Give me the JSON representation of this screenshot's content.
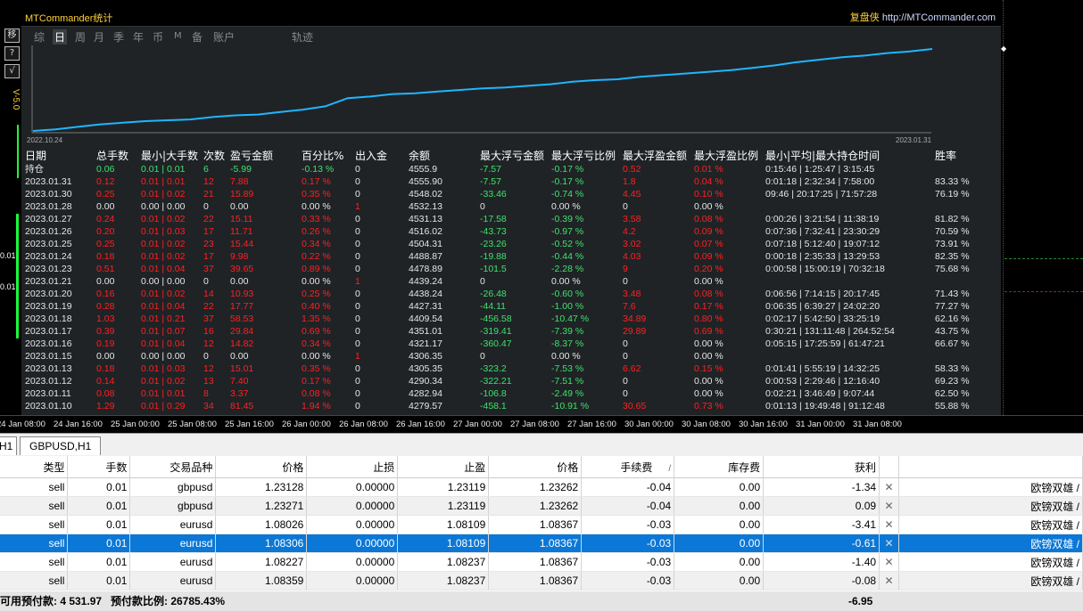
{
  "panel": {
    "title": "MTCommander统计",
    "site_label": "复盘侠",
    "site_url": "http://MTCommander.com",
    "tabs": [
      "综",
      "日",
      "周",
      "月",
      "季",
      "年",
      "币",
      "M",
      "备",
      "账户",
      "轨迹"
    ],
    "active_tab": "日"
  },
  "toolbar": {
    "buttons": [
      "移",
      "?",
      "√"
    ],
    "version": "V-5.0"
  },
  "equity": {
    "start_date": "2022.10.24",
    "end_date": "2023.01.31",
    "line_color": "#1fb6ff",
    "points": [
      0,
      0.02,
      0.05,
      0.08,
      0.1,
      0.12,
      0.13,
      0.14,
      0.17,
      0.19,
      0.2,
      0.23,
      0.26,
      0.3,
      0.4,
      0.42,
      0.45,
      0.46,
      0.48,
      0.5,
      0.52,
      0.53,
      0.55,
      0.57,
      0.6,
      0.62,
      0.63,
      0.66,
      0.68,
      0.7,
      0.72,
      0.74,
      0.77,
      0.8,
      0.84,
      0.87,
      0.9,
      0.92,
      0.95,
      0.97,
      1
    ]
  },
  "stats": {
    "headers": [
      "日期",
      "总手数",
      "最小|大手数",
      "次数",
      "盈亏金额",
      "百分比%",
      "出入金",
      "余额",
      "最大浮亏金额",
      "最大浮亏比例",
      "最大浮盈金额",
      "最大浮盈比例",
      "最小|平均|最大持仓时间",
      "胜率"
    ],
    "rows": [
      {
        "date": "持仓",
        "c": "g",
        "lots": "0.06",
        "minmax": "0.01 | 0.01",
        "n": "6",
        "pl": "-5.99",
        "pct": "-0.13 %",
        "io": "0",
        "bal": "4555.9",
        "mfl": "-7.57",
        "mflp": "-0.17 %",
        "mfp": "0.52",
        "mfpp": "0.01 %",
        "time": "0:15:46 | 1:25:47 | 3:15:45",
        "win": ""
      },
      {
        "date": "2023.01.31",
        "c": "r",
        "lots": "0.12",
        "minmax": "0.01 | 0.01",
        "n": "12",
        "pl": "7.88",
        "pct": "0.17 %",
        "io": "0",
        "bal": "4555.90",
        "mfl": "-7.57",
        "mflp": "-0.17 %",
        "mfp": "1.8",
        "mfpp": "0.04 %",
        "time": "0:01:18 | 2:32:34 | 7:58:00",
        "win": "83.33 %"
      },
      {
        "date": "2023.01.30",
        "c": "r",
        "lots": "0.25",
        "minmax": "0.01 | 0.02",
        "n": "21",
        "pl": "15.89",
        "pct": "0.35 %",
        "io": "0",
        "bal": "4548.02",
        "mfl": "-33.46",
        "mflp": "-0.74 %",
        "mfp": "4.45",
        "mfpp": "0.10 %",
        "time": "09:46 | 20:17:25 | 71:57:28",
        "win": "76.19 %"
      },
      {
        "date": "2023.01.28",
        "c": "w",
        "lots": "0.00",
        "minmax": "0.00 | 0.00",
        "n": "0",
        "pl": "0.00",
        "pct": "0.00 %",
        "io": "1",
        "bal": "4532.13",
        "mfl": "0",
        "mflp": "0.00 %",
        "mfp": "0",
        "mfpp": "0.00 %",
        "time": "",
        "win": ""
      },
      {
        "date": "2023.01.27",
        "c": "r",
        "lots": "0.24",
        "minmax": "0.01 | 0.02",
        "n": "22",
        "pl": "15.11",
        "pct": "0.33 %",
        "io": "0",
        "bal": "4531.13",
        "mfl": "-17.58",
        "mflp": "-0.39 %",
        "mfp": "3.58",
        "mfpp": "0.08 %",
        "time": "0:00:26 | 3:21:54 | 11:38:19",
        "win": "81.82 %"
      },
      {
        "date": "2023.01.26",
        "c": "r",
        "lots": "0.20",
        "minmax": "0.01 | 0.03",
        "n": "17",
        "pl": "11.71",
        "pct": "0.26 %",
        "io": "0",
        "bal": "4516.02",
        "mfl": "-43.73",
        "mflp": "-0.97 %",
        "mfp": "4.2",
        "mfpp": "0.09 %",
        "time": "0:07:36 | 7:32:41 | 23:30:29",
        "win": "70.59 %"
      },
      {
        "date": "2023.01.25",
        "c": "r",
        "lots": "0.25",
        "minmax": "0.01 | 0.02",
        "n": "23",
        "pl": "15.44",
        "pct": "0.34 %",
        "io": "0",
        "bal": "4504.31",
        "mfl": "-23.26",
        "mflp": "-0.52 %",
        "mfp": "3.02",
        "mfpp": "0.07 %",
        "time": "0:07:18 | 5:12:40 | 19:07:12",
        "win": "73.91 %"
      },
      {
        "date": "2023.01.24",
        "c": "r",
        "lots": "0.18",
        "minmax": "0.01 | 0.02",
        "n": "17",
        "pl": "9.98",
        "pct": "0.22 %",
        "io": "0",
        "bal": "4488.87",
        "mfl": "-19.88",
        "mflp": "-0.44 %",
        "mfp": "4.03",
        "mfpp": "0.09 %",
        "time": "0:00:18 | 2:35:33 | 13:29:53",
        "win": "82.35 %"
      },
      {
        "date": "2023.01.23",
        "c": "r",
        "lots": "0.51",
        "minmax": "0.01 | 0.04",
        "n": "37",
        "pl": "39.65",
        "pct": "0.89 %",
        "io": "0",
        "bal": "4478.89",
        "mfl": "-101.5",
        "mflp": "-2.28 %",
        "mfp": "9",
        "mfpp": "0.20 %",
        "time": "0:00:58 | 15:00:19 | 70:32:18",
        "win": "75.68 %"
      },
      {
        "date": "2023.01.21",
        "c": "w",
        "lots": "0.00",
        "minmax": "0.00 | 0.00",
        "n": "0",
        "pl": "0.00",
        "pct": "0.00 %",
        "io": "1",
        "bal": "4439.24",
        "mfl": "0",
        "mflp": "0.00 %",
        "mfp": "0",
        "mfpp": "0.00 %",
        "time": "",
        "win": ""
      },
      {
        "date": "2023.01.20",
        "c": "r",
        "lots": "0.16",
        "minmax": "0.01 | 0.02",
        "n": "14",
        "pl": "10.93",
        "pct": "0.25 %",
        "io": "0",
        "bal": "4438.24",
        "mfl": "-26.48",
        "mflp": "-0.60 %",
        "mfp": "3.48",
        "mfpp": "0.08 %",
        "time": "0:06:56 | 7:14:15 | 20:17:45",
        "win": "71.43 %"
      },
      {
        "date": "2023.01.19",
        "c": "r",
        "lots": "0.28",
        "minmax": "0.01 | 0.04",
        "n": "22",
        "pl": "17.77",
        "pct": "0.40 %",
        "io": "0",
        "bal": "4427.31",
        "mfl": "-44.11",
        "mflp": "-1.00 %",
        "mfp": "7.6",
        "mfpp": "0.17 %",
        "time": "0:06:35 | 6:39:27 | 24:02:20",
        "win": "77.27 %"
      },
      {
        "date": "2023.01.18",
        "c": "r",
        "lots": "1.03",
        "minmax": "0.01 | 0.21",
        "n": "37",
        "pl": "58.53",
        "pct": "1.35 %",
        "io": "0",
        "bal": "4409.54",
        "mfl": "-456.58",
        "mflp": "-10.47 %",
        "mfp": "34.89",
        "mfpp": "0.80 %",
        "time": "0:02:17 | 5:42:50 | 33:25:19",
        "win": "62.16 %"
      },
      {
        "date": "2023.01.17",
        "c": "r",
        "lots": "0.39",
        "minmax": "0.01 | 0.07",
        "n": "16",
        "pl": "29.84",
        "pct": "0.69 %",
        "io": "0",
        "bal": "4351.01",
        "mfl": "-319.41",
        "mflp": "-7.39 %",
        "mfp": "29.89",
        "mfpp": "0.69 %",
        "time": "0:30:21 | 131:11:48 | 264:52:54",
        "win": "43.75 %"
      },
      {
        "date": "2023.01.16",
        "c": "r",
        "lots": "0.19",
        "minmax": "0.01 | 0.04",
        "n": "12",
        "pl": "14.82",
        "pct": "0.34 %",
        "io": "0",
        "bal": "4321.17",
        "mfl": "-360.47",
        "mflp": "-8.37 %",
        "mfp": "0",
        "mfpp": "0.00 %",
        "time": "0:05:15 | 17:25:59 | 61:47:21",
        "win": "66.67 %"
      },
      {
        "date": "2023.01.15",
        "c": "w",
        "lots": "0.00",
        "minmax": "0.00 | 0.00",
        "n": "0",
        "pl": "0.00",
        "pct": "0.00 %",
        "io": "1",
        "bal": "4306.35",
        "mfl": "0",
        "mflp": "0.00 %",
        "mfp": "0",
        "mfpp": "0.00 %",
        "time": "",
        "win": ""
      },
      {
        "date": "2023.01.13",
        "c": "r",
        "lots": "0.18",
        "minmax": "0.01 | 0.03",
        "n": "12",
        "pl": "15.01",
        "pct": "0.35 %",
        "io": "0",
        "bal": "4305.35",
        "mfl": "-323.2",
        "mflp": "-7.53 %",
        "mfp": "6.62",
        "mfpp": "0.15 %",
        "time": "0:01:41 | 5:55:19 | 14:32:25",
        "win": "58.33 %"
      },
      {
        "date": "2023.01.12",
        "c": "r",
        "lots": "0.14",
        "minmax": "0.01 | 0.02",
        "n": "13",
        "pl": "7.40",
        "pct": "0.17 %",
        "io": "0",
        "bal": "4290.34",
        "mfl": "-322.21",
        "mflp": "-7.51 %",
        "mfp": "0",
        "mfpp": "0.00 %",
        "time": "0:00:53 | 2:29:46 | 12:16:40",
        "win": "69.23 %"
      },
      {
        "date": "2023.01.11",
        "c": "r",
        "lots": "0.08",
        "minmax": "0.01 | 0.01",
        "n": "8",
        "pl": "3.37",
        "pct": "0.08 %",
        "io": "0",
        "bal": "4282.94",
        "mfl": "-106.8",
        "mflp": "-2.49 %",
        "mfp": "0",
        "mfpp": "0.00 %",
        "time": "0:02:21 | 3:46:49 | 9:07:44",
        "win": "62.50 %"
      },
      {
        "date": "2023.01.10",
        "c": "r",
        "lots": "1.29",
        "minmax": "0.01 | 0.29",
        "n": "34",
        "pl": "81.45",
        "pct": "1.94 %",
        "io": "0",
        "bal": "4279.57",
        "mfl": "-458.1",
        "mflp": "-10.91 %",
        "mfp": "30.65",
        "mfpp": "0.73 %",
        "time": "0:01:13 | 19:49:48 | 91:12:48",
        "win": "55.88 %"
      }
    ]
  },
  "side_labels": [
    "0.01",
    "0.01"
  ],
  "time_axis": [
    "24 Jan 08:00",
    "24 Jan 16:00",
    "25 Jan 00:00",
    "25 Jan 08:00",
    "25 Jan 16:00",
    "26 Jan 00:00",
    "26 Jan 08:00",
    "26 Jan 16:00",
    "27 Jan 00:00",
    "27 Jan 08:00",
    "27 Jan 16:00",
    "30 Jan 00:00",
    "30 Jan 08:00",
    "30 Jan 16:00",
    "31 Jan 00:00",
    "31 Jan 08:00"
  ],
  "chart_tabs": [
    "H1",
    "GBPUSD,H1"
  ],
  "orders": {
    "headers": [
      "类型",
      "手数",
      "交易品种",
      "价格",
      "止损",
      "止盈",
      "价格",
      "手续费",
      "/",
      "库存费",
      "获利"
    ],
    "rows": [
      {
        "type": "sell",
        "lots": "0.01",
        "symbol": "gbpusd",
        "price": "1.23128",
        "sl": "0.00000",
        "tp": "1.23119",
        "cur": "1.23262",
        "comm": "-0.04",
        "swap": "0.00",
        "profit": "-1.34",
        "comment": "欧镑双雄 /"
      },
      {
        "type": "sell",
        "lots": "0.01",
        "symbol": "gbpusd",
        "price": "1.23271",
        "sl": "0.00000",
        "tp": "1.23119",
        "cur": "1.23262",
        "comm": "-0.04",
        "swap": "0.00",
        "profit": "0.09",
        "comment": "欧镑双雄 /"
      },
      {
        "type": "sell",
        "lots": "0.01",
        "symbol": "eurusd",
        "price": "1.08026",
        "sl": "0.00000",
        "tp": "1.08109",
        "cur": "1.08367",
        "comm": "-0.03",
        "swap": "0.00",
        "profit": "-3.41",
        "comment": "欧镑双雄 /"
      },
      {
        "type": "sell",
        "lots": "0.01",
        "symbol": "eurusd",
        "price": "1.08306",
        "sl": "0.00000",
        "tp": "1.08109",
        "cur": "1.08367",
        "comm": "-0.03",
        "swap": "0.00",
        "profit": "-0.61",
        "comment": "欧镑双雄 /"
      },
      {
        "type": "sell",
        "lots": "0.01",
        "symbol": "eurusd",
        "price": "1.08227",
        "sl": "0.00000",
        "tp": "1.08237",
        "cur": "1.08367",
        "comm": "-0.03",
        "swap": "0.00",
        "profit": "-1.40",
        "comment": "欧镑双雄 /"
      },
      {
        "type": "sell",
        "lots": "0.01",
        "symbol": "eurusd",
        "price": "1.08359",
        "sl": "0.00000",
        "tp": "1.08237",
        "cur": "1.08367",
        "comm": "-0.03",
        "swap": "0.00",
        "profit": "-0.08",
        "comment": "欧镑双雄 /"
      }
    ],
    "selected_row": 3,
    "close_glyph": "✕"
  },
  "summary": {
    "free_margin": "可用预付款: 4 531.97",
    "margin_level": "预付款比例: 26785.43%",
    "total": "-6.95"
  }
}
